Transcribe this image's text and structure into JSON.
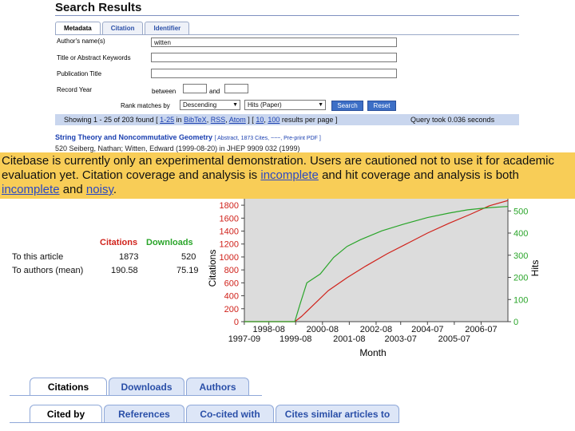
{
  "page": {
    "title": "Search Results"
  },
  "tabs": [
    "Metadata",
    "Citation",
    "Identifier"
  ],
  "form": {
    "author_label": "Author's name(s)",
    "author_value": "witten",
    "keywords_label": "Title or Abstract Keywords",
    "publication_label": "Publication Title",
    "year_label": "Record Year",
    "between_label": "between",
    "and_label": "and",
    "rank_label": "Rank matches by",
    "rank_order": "Descending",
    "rank_field": "Hits (Paper)",
    "search_button": "Search",
    "reset_button": "Reset"
  },
  "status": {
    "showing": "Showing 1 - 25 of 203 found [",
    "range": "1-25",
    "in_text": "in",
    "bibtex": "BibTeX",
    "rss": "RSS",
    "atom": "Atom",
    "sep": "] [",
    "p10": "10",
    "p100": "100",
    "per_page": "results per page ]",
    "query_time": "Query took 0.036 seconds"
  },
  "result": {
    "title": "String Theory and Noncommutative Geometry",
    "links": "[ Abstract, 1873 Cites, ~~~, Pre-print PDF ]",
    "line2": "520  Seiberg, Nathan; Witten, Edward (1999-08-20) in JHEP 9909 032 (1999)"
  },
  "banner": {
    "text1": "Citebase is currently only an experimental demonstration. Users are cautioned not to use it for academic evaluation yet. Citation coverage and analysis is",
    "link1": "incomplete",
    "text2": "and hit coverage and analysis is both",
    "link2": "incomplete",
    "text3": "and",
    "link3": "noisy",
    "text4": "."
  },
  "stats": {
    "col_citations": "Citations",
    "col_downloads": "Downloads",
    "row1_label": "To this article",
    "row1_citations": "1873",
    "row1_downloads": "520",
    "row2_label": "To authors (mean)",
    "row2_citations": "190.58",
    "row2_downloads": "75.19"
  },
  "chart_data": {
    "type": "line",
    "xlabel": "Month",
    "ylabel": "Citations",
    "y2label": "Hits",
    "x_ticks_top": [
      "1998-08",
      "2000-08",
      "2002-08",
      "2004-07",
      "2006-07"
    ],
    "x_ticks_bottom": [
      "1997-09",
      "1999-08",
      "2001-08",
      "2003-07",
      "2005-07"
    ],
    "y_ticks": [
      0,
      200,
      400,
      600,
      800,
      1000,
      1200,
      1400,
      1600,
      1800
    ],
    "y2_ticks": [
      0,
      100,
      200,
      300,
      400,
      500
    ],
    "ylim": [
      0,
      1900
    ],
    "y2lim": [
      0,
      555
    ],
    "xlim": [
      1997.67,
      2007.5
    ],
    "series": [
      {
        "name": "Citations",
        "axis": "left",
        "color": "#d0221b",
        "x": [
          1997.67,
          1999.55,
          1999.8,
          2000.3,
          2000.8,
          2001.5,
          2002.2,
          2003.0,
          2003.8,
          2004.5,
          2005.3,
          2006.1,
          2006.8,
          2007.5
        ],
        "y": [
          0,
          0,
          80,
          280,
          480,
          680,
          860,
          1050,
          1220,
          1370,
          1520,
          1660,
          1790,
          1873
        ]
      },
      {
        "name": "Downloads",
        "axis": "right",
        "color": "#2aa52a",
        "x": [
          1997.67,
          1999.55,
          1999.75,
          2000.0,
          2000.5,
          2001.0,
          2001.5,
          2002.0,
          2002.8,
          2003.6,
          2004.5,
          2005.3,
          2006.0,
          2006.8,
          2007.5
        ],
        "y": [
          0,
          0,
          80,
          175,
          215,
          290,
          340,
          370,
          410,
          440,
          470,
          490,
          505,
          515,
          520
        ]
      }
    ]
  },
  "lower_tabs": [
    "Citations",
    "Downloads",
    "Authors"
  ],
  "lower_tabs2": [
    "Cited by",
    "References",
    "Co-cited with",
    "Cites similar articles to"
  ]
}
